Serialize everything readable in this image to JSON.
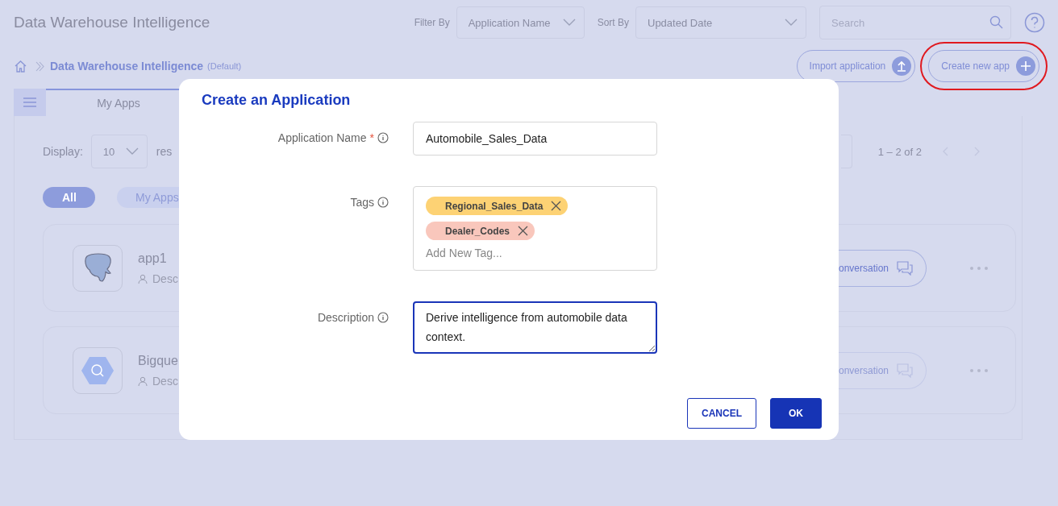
{
  "header": {
    "title": "Data Warehouse Intelligence",
    "filter_label": "Filter By",
    "filter_value": "Application Name",
    "sort_label": "Sort By",
    "sort_value": "Updated Date",
    "search": {
      "placeholder": "Search"
    }
  },
  "breadcrumb": {
    "current": "Data Warehouse Intelligence",
    "suffix": "(Default)"
  },
  "actions": [
    {
      "label": "Import application",
      "kind": "upload",
      "highlighted": false
    },
    {
      "label": "Create new app",
      "kind": "plus",
      "highlighted": true
    }
  ],
  "tabs": [
    {
      "label": "My Apps",
      "selected": true
    }
  ],
  "list_controls": {
    "display_label": "Display:",
    "page_size": "10",
    "results_fragment": "res",
    "range": "1 – 2 of 2"
  },
  "chips": [
    {
      "label": "All",
      "selected": true
    },
    {
      "label": "My Apps",
      "selected": false
    }
  ],
  "apps": [
    {
      "name": "app1",
      "kind": "postgres",
      "description_fragment": "Desc",
      "action_fragment": "onversation",
      "disabled": false
    },
    {
      "name": "Bigque",
      "kind": "bigquery",
      "description_fragment": "Desc",
      "action_fragment": "onversation",
      "disabled": true
    }
  ],
  "dialog": {
    "title": "Create an Application",
    "fields": [
      {
        "label": "Application Name",
        "required_mark": "*",
        "kind": "text",
        "value": "Automobile_Sales_Data",
        "focused": false
      },
      {
        "label": "Tags",
        "kind": "tags",
        "tags": [
          {
            "label": "Regional_Sales_Data",
            "color": "#fdd274"
          },
          {
            "label": "Dealer_Codes",
            "color": "#f9c7bc"
          }
        ],
        "placeholder": "Add New Tag..."
      },
      {
        "label": "Description",
        "kind": "textarea",
        "value": "Derive intelligence from automobile data context.",
        "focused": true
      }
    ],
    "buttons": [
      {
        "label": "CANCEL",
        "kind": "secondary"
      },
      {
        "label": "OK",
        "kind": "primary"
      }
    ]
  }
}
